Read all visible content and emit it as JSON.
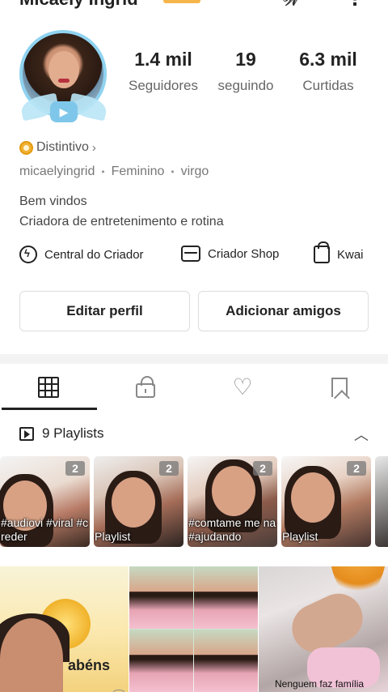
{
  "header": {
    "profile_name": "Micaely Ingrid",
    "more_icon": "more-vertical-icon"
  },
  "stats": [
    {
      "value": "1.4 mil",
      "label": "Seguidores"
    },
    {
      "value": "19",
      "label": "seguindo"
    },
    {
      "value": "6.3 mil",
      "label": "Curtidas"
    }
  ],
  "badge": {
    "label": "Distintivo",
    "chevron": "›"
  },
  "meta": {
    "username": "micaelyingrid",
    "dot": "•",
    "gender": "Feminino",
    "sign": "virgo"
  },
  "bio": {
    "line1": "Bem vindos",
    "line2": "Criadora de entretenimento e rotina"
  },
  "links": [
    {
      "label": "Central do Criador",
      "icon": "lightning-circle-icon"
    },
    {
      "label": "Criador Shop",
      "icon": "shop-icon"
    },
    {
      "label": "Kwai",
      "icon": "bag-icon"
    }
  ],
  "buttons": {
    "edit_profile": "Editar perfil",
    "add_friends": "Adicionar amigos"
  },
  "tabs": [
    {
      "name": "posts",
      "icon": "grid-icon",
      "active": true
    },
    {
      "name": "private",
      "icon": "lock-icon",
      "active": false
    },
    {
      "name": "liked",
      "icon": "heart-icon",
      "active": false
    },
    {
      "name": "saved",
      "icon": "bookmark-icon",
      "active": false
    }
  ],
  "playlists": {
    "title": "9 Playlists",
    "collapse_glyph": "︿",
    "items": [
      {
        "count": "2",
        "caption": "#audiovi #viral #creder"
      },
      {
        "count": "2",
        "caption": "Playlist"
      },
      {
        "count": "2",
        "caption": "#comtame me na #ajudando"
      },
      {
        "count": "2",
        "caption": "Playlist"
      }
    ]
  },
  "videos": [
    {
      "caption": "abéns"
    },
    {
      "caption": ""
    },
    {
      "caption": "Nenguem faz família"
    }
  ],
  "colors": {
    "accent_badge": "#f0b232",
    "avatar_ring": "#8fd3f0",
    "separator": "#f3f3f3"
  }
}
